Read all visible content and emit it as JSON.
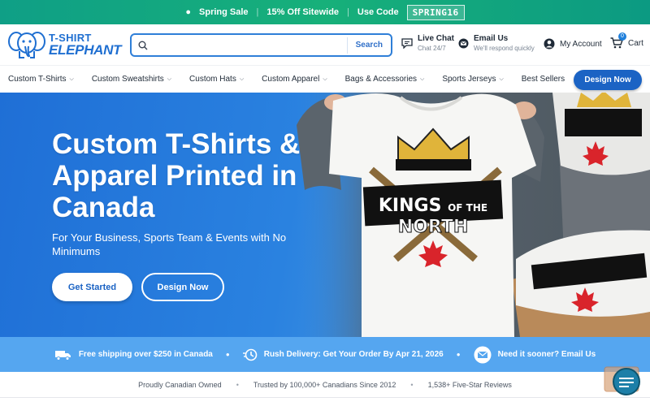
{
  "promo": {
    "text1": "Spring Sale",
    "text2": "15% Off Sitewide",
    "text3": "Use Code",
    "code": "SPRING16"
  },
  "header": {
    "logo_line1": "T-SHIRT",
    "logo_line2": "ELEPHANT",
    "search_placeholder": "",
    "search_button": "Search",
    "live_chat_title": "Live Chat",
    "live_chat_sub": "Chat 24/7",
    "email_title": "Email Us",
    "email_sub": "We'll respond quickly",
    "account": "My Account",
    "cart": "Cart",
    "cart_count": "0"
  },
  "nav": {
    "items": [
      {
        "label": "Custom T-Shirts",
        "dropdown": true
      },
      {
        "label": "Custom Sweatshirts",
        "dropdown": true
      },
      {
        "label": "Custom Hats",
        "dropdown": true
      },
      {
        "label": "Custom Apparel",
        "dropdown": true
      },
      {
        "label": "Bags & Accessories",
        "dropdown": true
      },
      {
        "label": "Sports Jerseys",
        "dropdown": true
      },
      {
        "label": "Best Sellers",
        "dropdown": false
      }
    ],
    "cta": "Design Now"
  },
  "hero": {
    "title": "Custom T-Shirts & Apparel Printed in Canada",
    "subtitle": "For Your Business, Sports Team & Events with No Minimums",
    "primary_button": "Get Started",
    "secondary_button": "Design Now",
    "shirt_text_line1": "KINGS",
    "shirt_text_line2": "OF THE",
    "shirt_text_line3": "NORTH"
  },
  "strip": {
    "item1": "Free shipping over $250 in Canada",
    "item2": "Rush Delivery: Get Your Order By Apr 21, 2026",
    "item3": "Need it sooner? Email Us"
  },
  "trust": {
    "item1": "Proudly Canadian Owned",
    "item2": "Trusted by 100,000+ Canadians Since 2012",
    "item3": "1,538+ Five-Star Reviews"
  },
  "colors": {
    "brand_blue": "#1b63c4",
    "promo_green": "#17b07a",
    "hero_blue": "#2a82e0",
    "strip_blue": "#55a6f0"
  }
}
